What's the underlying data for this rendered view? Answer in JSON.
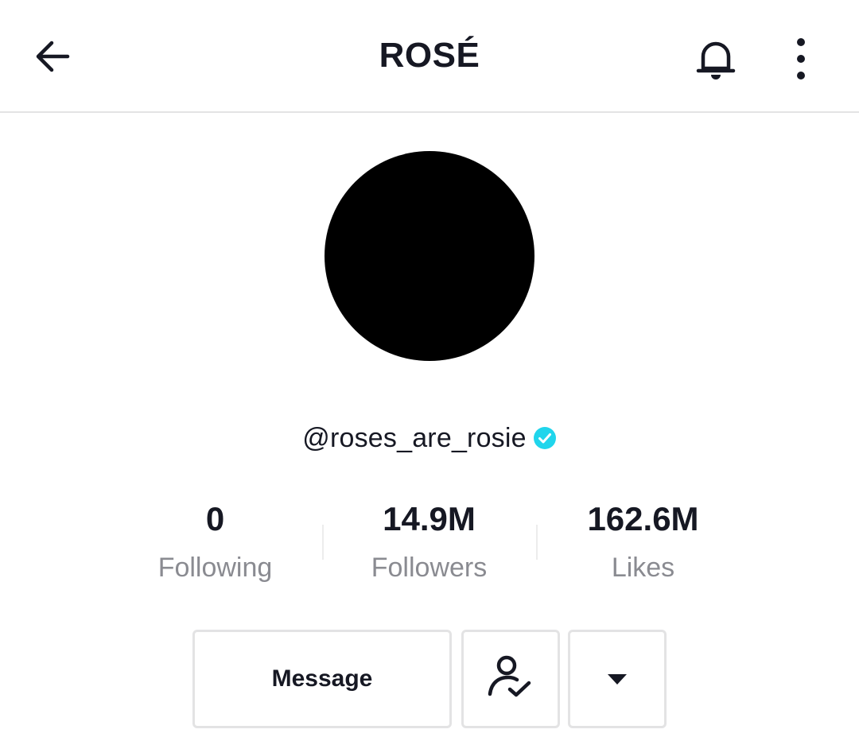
{
  "header": {
    "title": "ROSÉ",
    "back_icon": "arrow-left-icon",
    "bell_icon": "bell-icon",
    "more_icon": "vertical-dots-icon"
  },
  "profile": {
    "username": "@roses_are_rosie",
    "verified_icon": "verified-badge-icon",
    "verified_color": "#20d5ec",
    "avatar_color": "#000000"
  },
  "stats": [
    {
      "value": "0",
      "label": "Following"
    },
    {
      "value": "14.9M",
      "label": "Followers"
    },
    {
      "value": "162.6M",
      "label": "Likes"
    }
  ],
  "actions": {
    "message_label": "Message",
    "following_icon": "user-check-icon",
    "dropdown_icon": "caret-down-icon"
  },
  "colors": {
    "text_primary": "#161823",
    "text_secondary": "#8a8b91",
    "border": "#e3e3e4"
  }
}
